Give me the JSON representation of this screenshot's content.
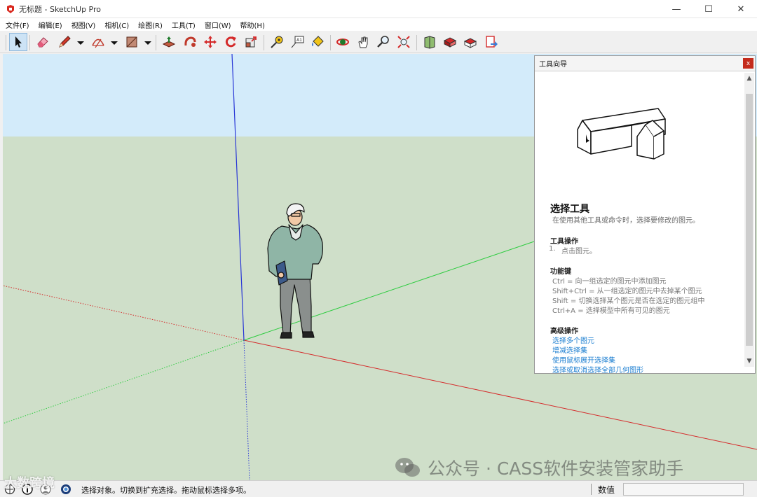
{
  "window": {
    "title": "无标题 - SketchUp Pro",
    "min_glyph": "—",
    "max_glyph": "☐",
    "close_glyph": "✕"
  },
  "menu": [
    "文件(F)",
    "编辑(E)",
    "视图(V)",
    "相机(C)",
    "绘图(R)",
    "工具(T)",
    "窗口(W)",
    "帮助(H)"
  ],
  "toolbar": {
    "buttons": [
      "select-arrow-icon",
      "eraser-icon",
      "pencil-line-icon",
      "arc-icon",
      "rectangle-icon",
      "push-pull-icon",
      "follow-me-icon",
      "move-icon",
      "rotate-icon",
      "scale-icon",
      "tape-measure-icon",
      "text-label-icon",
      "paint-bucket-icon",
      "orbit-icon",
      "pan-hand-icon",
      "zoom-icon",
      "zoom-extents-icon",
      "warehouse-icon",
      "extension-warehouse-icon",
      "share-model-icon",
      "send-to-layout-icon"
    ],
    "active": "select-arrow-icon"
  },
  "instructor": {
    "header": "工具向导",
    "close_glyph": "x",
    "scroll_up": "▲",
    "scroll_down": "▼",
    "tool_name": "选择工具",
    "tool_desc": "在使用其他工具或命令时，选择要修改的图元。",
    "operations_title": "工具操作",
    "operations": [
      {
        "num": "1.",
        "text": "点击图元。"
      }
    ],
    "modifiers_title": "功能键",
    "modifiers": [
      "Ctrl = 向一组选定的图元中添加图元",
      "Shift+Ctrl = 从一组选定的图元中去掉某个图元",
      "Shift = 切换选择某个图元是否在选定的图元组中",
      "Ctrl+A = 选择模型中所有可见的图元"
    ],
    "advanced_title": "高级操作",
    "advanced_links": [
      "选择多个图元",
      "增减选择集",
      "使用鼠标展开选择集",
      "选择或取消选择全部几何图形"
    ]
  },
  "status": {
    "hint": "选择对象。切换到扩充选择。拖动鼠标选择多项。",
    "measurements_label": "数值",
    "measurements_value": "",
    "icons": [
      "geo-location-icon",
      "info-icon",
      "credits-icon",
      "account-icon"
    ]
  },
  "watermarks": {
    "right": "公众号 · CASS软件安装管家助手",
    "left": "大数跨境"
  },
  "colors": {
    "sky": "#d3ebfa",
    "ground": "#cfdfc9",
    "axis_red": "#d52b2b",
    "axis_green": "#2ecc40",
    "axis_blue": "#2836d6",
    "link": "#1d7fd1"
  }
}
